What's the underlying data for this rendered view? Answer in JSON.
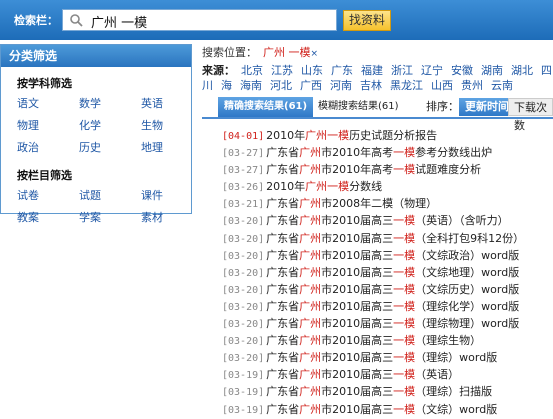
{
  "search": {
    "label": "检索栏：",
    "query": "广州 一模",
    "button": "找资料"
  },
  "sidebar": {
    "title": "分类筛选",
    "group1_title": "按学科筛选",
    "subjects": [
      "语文",
      "数学",
      "英语",
      "物理",
      "化学",
      "生物",
      "政治",
      "历史",
      "地理"
    ],
    "group2_title": "按栏目筛选",
    "columns": [
      "试卷",
      "试题",
      "课件",
      "教案",
      "学案",
      "素材"
    ]
  },
  "location": {
    "label": "搜索位置：",
    "value": "广州 一模",
    "remove": "×"
  },
  "source": {
    "label": "来源：",
    "regions": [
      "北京",
      "江苏",
      "山东",
      "广东",
      "福建",
      "浙江",
      "辽宁",
      "安徽",
      "湖南",
      "湖北",
      "四川",
      "海",
      "海南",
      "河北",
      "广西",
      "河南",
      "吉林",
      "黑龙江",
      "山西",
      "贵州",
      "云南"
    ]
  },
  "tabs": {
    "exact": "精确搜索结果(61)",
    "fuzzy": "模糊搜索结果(61)",
    "sort_label": "排序：",
    "sort_time": "更新时间",
    "sort_downloads": "下载次数"
  },
  "results": [
    {
      "date": "[04-01]",
      "new": true,
      "parts": [
        "2010年",
        "广州一模",
        "历史试题分析报告"
      ]
    },
    {
      "date": "[03-27]",
      "new": false,
      "parts": [
        "广东省",
        "广州",
        "市2010年高考",
        "一模",
        "参考分数线出炉"
      ]
    },
    {
      "date": "[03-27]",
      "new": false,
      "parts": [
        "广东省",
        "广州",
        "市2010年高考",
        "一模",
        "试题难度分析"
      ]
    },
    {
      "date": "[03-26]",
      "new": false,
      "parts": [
        "2010年",
        "广州一模",
        "分数线"
      ]
    },
    {
      "date": "[03-21]",
      "new": false,
      "parts": [
        "广东省",
        "广州",
        "市2008年二模（物理）"
      ]
    },
    {
      "date": "[03-20]",
      "new": false,
      "parts": [
        "广东省",
        "广州",
        "市2010届高三",
        "一模",
        "（英语）（含听力）"
      ]
    },
    {
      "date": "[03-20]",
      "new": false,
      "parts": [
        "广东省",
        "广州",
        "市2010届高三",
        "一模",
        "（全科打包9科12份）"
      ]
    },
    {
      "date": "[03-20]",
      "new": false,
      "parts": [
        "广东省",
        "广州",
        "市2010届高三",
        "一模",
        "（文综政治）word版"
      ]
    },
    {
      "date": "[03-20]",
      "new": false,
      "parts": [
        "广东省",
        "广州",
        "市2010届高三",
        "一模",
        "（文综地理）word版"
      ]
    },
    {
      "date": "[03-20]",
      "new": false,
      "parts": [
        "广东省",
        "广州",
        "市2010届高三",
        "一模",
        "（文综历史）word版"
      ]
    },
    {
      "date": "[03-20]",
      "new": false,
      "parts": [
        "广东省",
        "广州",
        "市2010届高三",
        "一模",
        "（理综化学）word版"
      ]
    },
    {
      "date": "[03-20]",
      "new": false,
      "parts": [
        "广东省",
        "广州",
        "市2010届高三",
        "一模",
        "（理综物理）word版"
      ]
    },
    {
      "date": "[03-20]",
      "new": false,
      "parts": [
        "广东省",
        "广州",
        "市2010届高三",
        "一模",
        "（理综生物）"
      ]
    },
    {
      "date": "[03-20]",
      "new": false,
      "parts": [
        "广东省",
        "广州",
        "市2010届高三",
        "一模",
        "（理综）word版"
      ]
    },
    {
      "date": "[03-19]",
      "new": false,
      "parts": [
        "广东省",
        "广州",
        "市2010届高三",
        "一模",
        "（英语）"
      ]
    },
    {
      "date": "[03-19]",
      "new": false,
      "parts": [
        "广东省",
        "广州",
        "市2010届高三",
        "一模",
        "（理综）扫描版"
      ]
    },
    {
      "date": "[03-19]",
      "new": false,
      "parts": [
        "广东省",
        "广州",
        "市2010届高三",
        "一模",
        "（文综）word版"
      ]
    }
  ]
}
